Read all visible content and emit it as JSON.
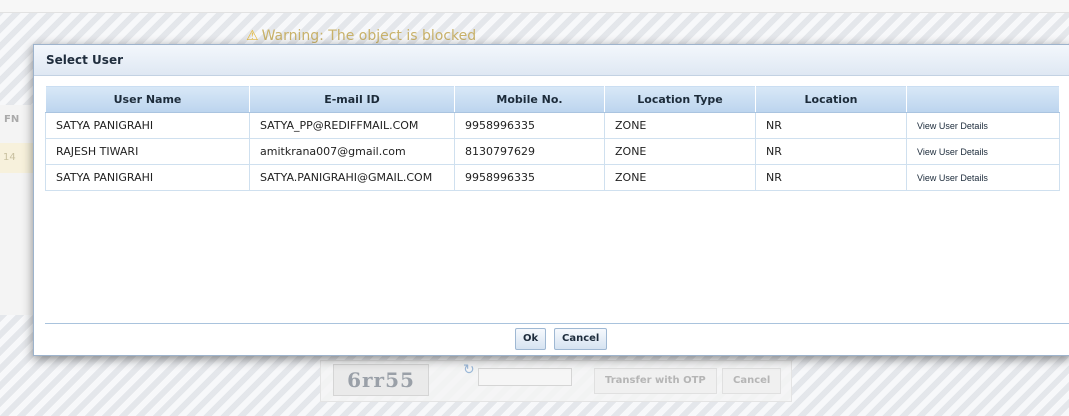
{
  "background": {
    "warning_text": "Warning: The object is blocked",
    "fn_label": "FN",
    "row_number": "14",
    "captcha_text": "6rr55",
    "otp_button": "Transfer with OTP",
    "cancel_button": "Cancel"
  },
  "dialog": {
    "title": "Select User",
    "columns": [
      "User Name",
      "E-mail ID",
      "Mobile No.",
      "Location Type",
      "Location",
      ""
    ],
    "rows": [
      {
        "name": "SATYA PANIGRAHI",
        "email": "SATYA_PP@REDIFFMAIL.COM",
        "mobile": "9958996335",
        "location_type": "ZONE",
        "location": "NR",
        "action": "View User Details"
      },
      {
        "name": "RAJESH TIWARI",
        "email": "amitkrana007@gmail.com",
        "mobile": "8130797629",
        "location_type": "ZONE",
        "location": "NR",
        "action": "View User Details"
      },
      {
        "name": "SATYA PANIGRAHI",
        "email": "SATYA.PANIGRAHI@GMAIL.COM",
        "mobile": "9958996335",
        "location_type": "ZONE",
        "location": "NR",
        "action": "View User Details"
      }
    ],
    "ok_label": "Ok",
    "cancel_label": "Cancel"
  },
  "colors": {
    "header_gradient_top": "#d8e8f7",
    "header_gradient_bottom": "#bcd4ee",
    "dialog_border": "#9db3cc"
  }
}
